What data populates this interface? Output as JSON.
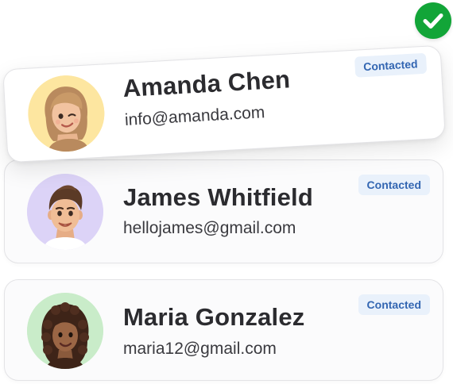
{
  "contacts": [
    {
      "name": "Amanda Chen",
      "email": "info@amanda.com",
      "status": "Contacted",
      "avatar_icon": "memoji-woman-blonde-winking-avatar",
      "avatar_bg": "#fde6a0",
      "selected": true
    },
    {
      "name": "James Whitfield",
      "email": "hellojames@gmail.com",
      "status": "Contacted",
      "avatar_icon": "memoji-man-brown-hair-avatar",
      "avatar_bg": "#dcd3f7",
      "selected": false
    },
    {
      "name": "Maria Gonzalez",
      "email": "maria12@gmail.com",
      "status": "Contacted",
      "avatar_icon": "memoji-woman-curly-hair-avatar",
      "avatar_bg": "#c9ecc9",
      "selected": false
    }
  ],
  "selection_indicator": {
    "icon": "checkmark-circle-icon",
    "color": "#12a538"
  },
  "badge_colors": {
    "background": "#e9f1fb",
    "text": "#3366b2"
  }
}
